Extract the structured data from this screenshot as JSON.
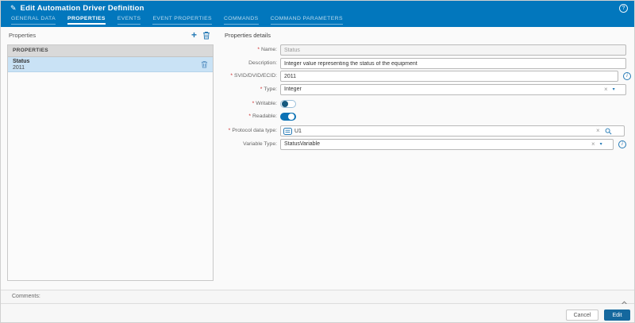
{
  "header": {
    "title": "Edit Automation Driver Definition",
    "tabs": [
      {
        "label": "GENERAL DATA",
        "active": false
      },
      {
        "label": "PROPERTIES",
        "active": true
      },
      {
        "label": "EVENTS",
        "active": false
      },
      {
        "label": "EVENT PROPERTIES",
        "active": false
      },
      {
        "label": "COMMANDS",
        "active": false
      },
      {
        "label": "COMMAND PARAMETERS",
        "active": false
      }
    ]
  },
  "icons": {
    "pencil": "✎",
    "help": "?",
    "add": "+",
    "info": "i",
    "clear": "×",
    "dropdown": "▾"
  },
  "left_panel": {
    "title": "Properties",
    "column_header": "PROPERTIES",
    "rows": [
      {
        "name": "Status",
        "id": "2011",
        "selected": true
      }
    ]
  },
  "details": {
    "title": "Properties details",
    "required_marker": "*",
    "name": {
      "label": "Name:",
      "required": true,
      "value": "Status",
      "disabled": true
    },
    "description": {
      "label": "Description:",
      "required": false,
      "value": "Integer value representing the status of the equipment"
    },
    "svid": {
      "label": "SVID/DVID/ECID:",
      "required": true,
      "value": "2011"
    },
    "type": {
      "label": "Type:",
      "required": true,
      "value": "Integer"
    },
    "writable": {
      "label": "Writable:",
      "required": true,
      "state": "off"
    },
    "readable": {
      "label": "Readable:",
      "required": true,
      "state": "on"
    },
    "protocol_data_type": {
      "label": "Protocol data type:",
      "required": true,
      "value": "U1"
    },
    "variable_type": {
      "label": "Variable Type:",
      "required": false,
      "value": "StatusVariable"
    }
  },
  "comments": {
    "label": "Comments:"
  },
  "footer": {
    "cancel_label": "Cancel",
    "edit_label": "Edit"
  },
  "colors": {
    "header_blue": "#0277bd",
    "accent_blue": "#2479b5",
    "toggle_on": "#0b72b5",
    "edit_button": "#15689e",
    "selected_row": "#c9e2f5",
    "required_red": "#cc2222"
  }
}
